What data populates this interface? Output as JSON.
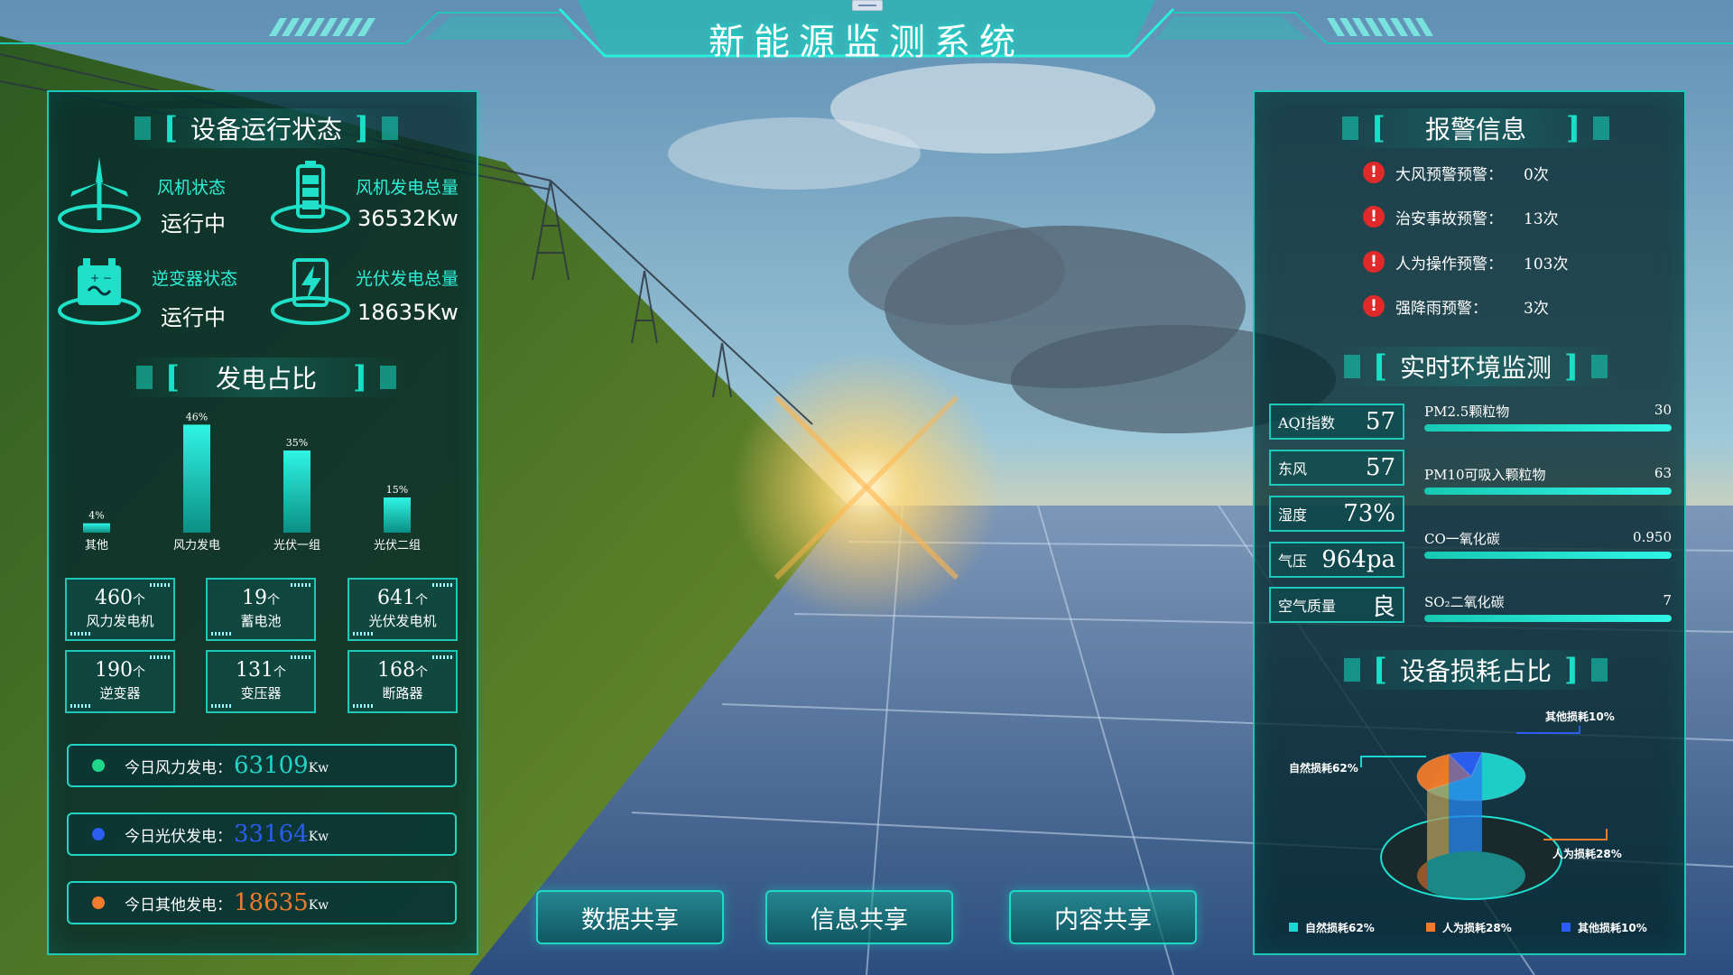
{
  "header": {
    "title": "新能源监测系统"
  },
  "left": {
    "status_title": "设备运行状态",
    "status": [
      {
        "label": "风机状态",
        "value": "运行中",
        "icon": "wind-turbine-icon"
      },
      {
        "label": "风机发电总量",
        "value": "36532Kw",
        "icon": "battery-icon"
      },
      {
        "label": "逆变器状态",
        "value": "运行中",
        "icon": "inverter-icon"
      },
      {
        "label": "光伏发电总量",
        "value": "18635Kw",
        "icon": "solar-charge-icon"
      }
    ],
    "ratio_title": "发电占比",
    "tiles": [
      {
        "num": "460",
        "unit": "个",
        "name": "风力发电机"
      },
      {
        "num": "19",
        "unit": "个",
        "name": "蓄电池"
      },
      {
        "num": "641",
        "unit": "个",
        "name": "光伏发电机"
      },
      {
        "num": "190",
        "unit": "个",
        "name": "逆变器"
      },
      {
        "num": "131",
        "unit": "个",
        "name": "变压器"
      },
      {
        "num": "168",
        "unit": "个",
        "name": "断路器"
      }
    ],
    "today": [
      {
        "label": "今日风力发电：",
        "value": "63109",
        "unit": "Kw",
        "color": "#1fd68a"
      },
      {
        "label": "今日光伏发电：",
        "value": "33164",
        "unit": "Kw",
        "color": "#2a5df0"
      },
      {
        "label": "今日其他发电：",
        "value": "18635",
        "unit": "Kw",
        "color": "#f07b2a"
      }
    ]
  },
  "buttons": [
    {
      "label": "数据共享"
    },
    {
      "label": "信息共享"
    },
    {
      "label": "内容共享"
    }
  ],
  "right": {
    "alarm_title": "报警信息",
    "alarms": [
      {
        "label": "大风预警预警：",
        "count": "0次"
      },
      {
        "label": "治安事故预警：",
        "count": "13次"
      },
      {
        "label": "人为操作预警：",
        "count": "103次"
      },
      {
        "label": "强降雨预警：",
        "count": "3次"
      }
    ],
    "env_title": "实时环境监测",
    "env_boxes": [
      {
        "label": "AQI指数",
        "value": "57"
      },
      {
        "label": "东风",
        "value": "57"
      },
      {
        "label": "湿度",
        "value": "73%"
      },
      {
        "label": "气压",
        "value": "964pa"
      },
      {
        "label": "空气质量",
        "value": "良"
      }
    ],
    "env_bars": [
      {
        "label": "PM2.5颗粒物",
        "value": "30",
        "fraction": 1.0
      },
      {
        "label": "PM10可吸入颗粒物",
        "value": "63",
        "fraction": 1.0
      },
      {
        "label": "CO一氧化碳",
        "value": "0.950",
        "fraction": 1.0
      },
      {
        "label": "SO₂二氧化碳",
        "value": "7",
        "fraction": 1.0
      }
    ],
    "wear_title": "设备损耗占比"
  },
  "colors": {
    "accent": "#1cc9b8",
    "teal_value": "#2ff0d8",
    "alarm_red": "#e02a2a",
    "wind_value": "#1fd6c8",
    "solar_value": "#2a5df0",
    "other_value": "#f07b2a"
  },
  "chart_data": [
    {
      "type": "bar",
      "categories": [
        "其他",
        "风力发电",
        "光伏一组",
        "光伏二组"
      ],
      "values": [
        4,
        46,
        35,
        15
      ],
      "value_labels": [
        "4%",
        "46%",
        "35%",
        "15%"
      ],
      "ylim": [
        0,
        50
      ],
      "grid": false
    },
    {
      "type": "pie",
      "categories": [
        "自然损耗62%",
        "人为损耗28%",
        "其他损耗10%"
      ],
      "values": [
        62,
        28,
        10
      ],
      "legend": [
        "自然损耗62%",
        "人为损耗28%",
        "其他损耗10%"
      ],
      "legend_position": "bottom",
      "colors": [
        "#1ed6d0",
        "#f07b2a",
        "#2a5df0"
      ]
    }
  ]
}
